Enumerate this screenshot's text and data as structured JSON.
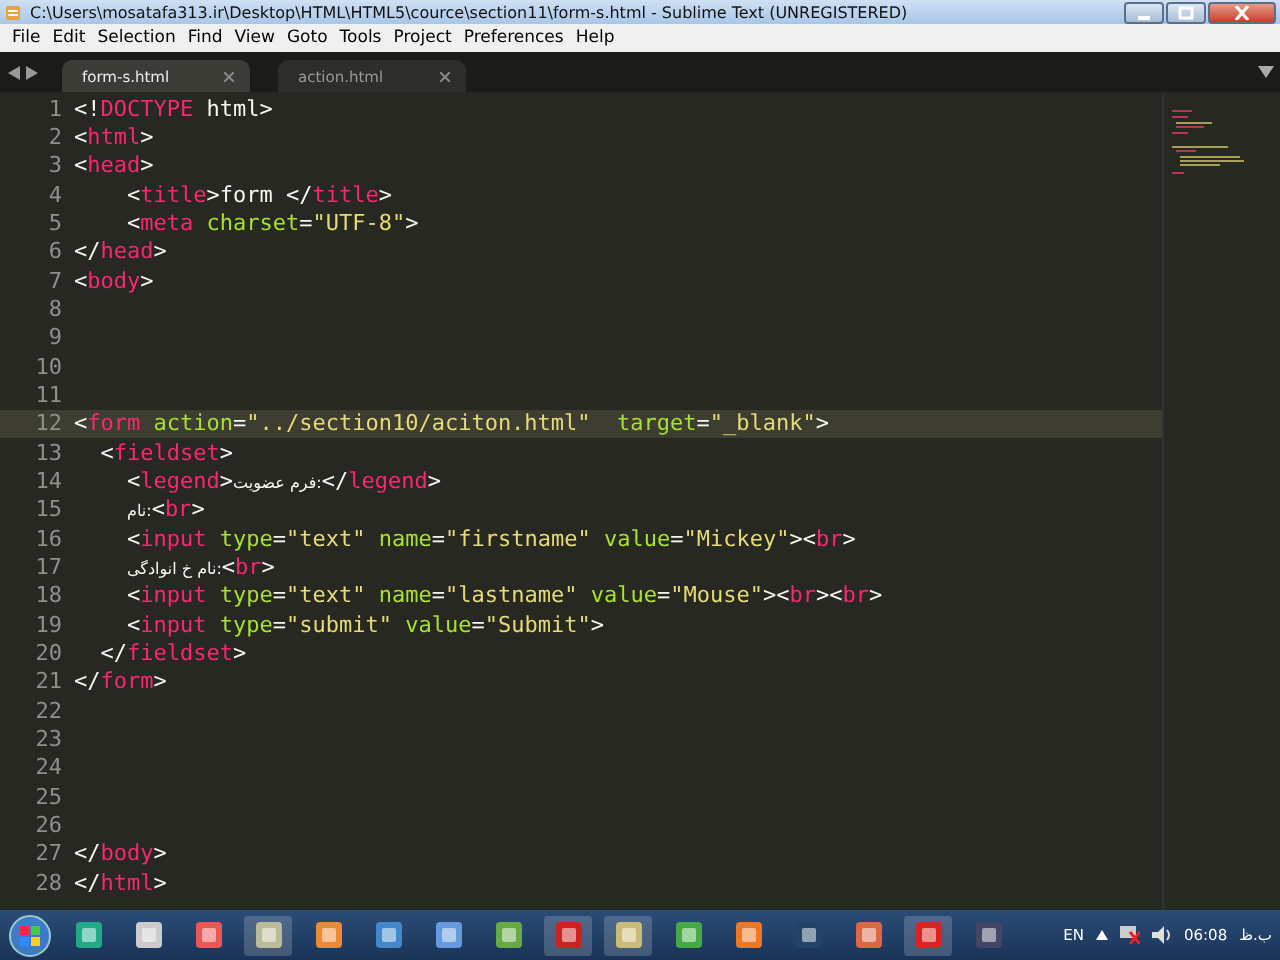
{
  "window": {
    "title": "C:\\Users\\mosatafa313.ir\\Desktop\\HTML\\HTML5\\cource\\section11\\form-s.html - Sublime Text (UNREGISTERED)"
  },
  "menu": [
    "File",
    "Edit",
    "Selection",
    "Find",
    "View",
    "Goto",
    "Tools",
    "Project",
    "Preferences",
    "Help"
  ],
  "tabs": [
    {
      "label": "form-s.html",
      "selected": true
    },
    {
      "label": "action.html",
      "selected": false
    }
  ],
  "editor": {
    "lines": [
      {
        "number": "1",
        "current": false,
        "tokens": [
          {
            "kind": "punct",
            "text": "<!"
          },
          {
            "kind": "tag",
            "text": "DOCTYPE"
          },
          {
            "kind": "plain",
            "text": " html"
          },
          {
            "kind": "punct",
            "text": ">"
          }
        ]
      },
      {
        "number": "2",
        "current": false,
        "tokens": [
          {
            "kind": "punct",
            "text": "<"
          },
          {
            "kind": "tag",
            "text": "html"
          },
          {
            "kind": "punct",
            "text": ">"
          }
        ]
      },
      {
        "number": "3",
        "current": false,
        "tokens": [
          {
            "kind": "punct",
            "text": "<"
          },
          {
            "kind": "tag",
            "text": "head"
          },
          {
            "kind": "punct",
            "text": ">"
          }
        ]
      },
      {
        "number": "4",
        "current": false,
        "tokens": [
          {
            "kind": "punct",
            "text": "    <"
          },
          {
            "kind": "tag",
            "text": "title"
          },
          {
            "kind": "punct",
            "text": ">"
          },
          {
            "kind": "plain",
            "text": "form "
          },
          {
            "kind": "punct",
            "text": "</"
          },
          {
            "kind": "tag",
            "text": "title"
          },
          {
            "kind": "punct",
            "text": ">"
          }
        ]
      },
      {
        "number": "5",
        "current": false,
        "tokens": [
          {
            "kind": "punct",
            "text": "    <"
          },
          {
            "kind": "tag",
            "text": "meta"
          },
          {
            "kind": "attr",
            "text": " charset"
          },
          {
            "kind": "punct",
            "text": "="
          },
          {
            "kind": "string",
            "text": "\"UTF-8\""
          },
          {
            "kind": "punct",
            "text": ">"
          }
        ]
      },
      {
        "number": "6",
        "current": false,
        "tokens": [
          {
            "kind": "punct",
            "text": "</"
          },
          {
            "kind": "tag",
            "text": "head"
          },
          {
            "kind": "punct",
            "text": ">"
          }
        ]
      },
      {
        "number": "7",
        "current": false,
        "tokens": [
          {
            "kind": "punct",
            "text": "<"
          },
          {
            "kind": "tag",
            "text": "body"
          },
          {
            "kind": "punct",
            "text": ">"
          }
        ]
      },
      {
        "number": "8",
        "current": false
      },
      {
        "number": "9",
        "current": false
      },
      {
        "number": "10",
        "current": false
      },
      {
        "number": "11",
        "current": false
      },
      {
        "number": "12",
        "current": true,
        "tokens": [
          {
            "kind": "punct",
            "text": "<"
          },
          {
            "kind": "tag",
            "text": "form"
          },
          {
            "kind": "attr",
            "text": " action"
          },
          {
            "kind": "punct",
            "text": "="
          },
          {
            "kind": "string",
            "text": "\"../section10/aciton.html\""
          },
          {
            "kind": "attr",
            "text": "  target"
          },
          {
            "kind": "punct",
            "text": "="
          },
          {
            "kind": "string",
            "text": "\"_blank\""
          },
          {
            "kind": "punct",
            "text": ">"
          }
        ]
      },
      {
        "number": "13",
        "current": false,
        "tokens": [
          {
            "kind": "punct",
            "text": "  <"
          },
          {
            "kind": "tag",
            "text": "fieldset"
          },
          {
            "kind": "punct",
            "text": ">"
          }
        ]
      },
      {
        "number": "14",
        "current": false,
        "tokens": [
          {
            "kind": "punct",
            "text": "    <"
          },
          {
            "kind": "tag",
            "text": "legend"
          },
          {
            "kind": "punct",
            "text": ">"
          },
          {
            "kind": "rtl",
            "text": "تیوضع مرف:"
          },
          {
            "kind": "punct",
            "text": "</"
          },
          {
            "kind": "tag",
            "text": "legend"
          },
          {
            "kind": "punct",
            "text": ">"
          }
        ]
      },
      {
        "number": "15",
        "current": false,
        "tokens": [
          {
            "kind": "rtl",
            "text": "    مان:"
          },
          {
            "kind": "punct",
            "text": "<"
          },
          {
            "kind": "tag",
            "text": "br"
          },
          {
            "kind": "punct",
            "text": ">"
          }
        ]
      },
      {
        "number": "16",
        "current": false,
        "tokens": [
          {
            "kind": "punct",
            "text": "    <"
          },
          {
            "kind": "tag",
            "text": "input"
          },
          {
            "kind": "attr",
            "text": " type"
          },
          {
            "kind": "punct",
            "text": "="
          },
          {
            "kind": "string",
            "text": "\"text\""
          },
          {
            "kind": "attr",
            "text": " name"
          },
          {
            "kind": "punct",
            "text": "="
          },
          {
            "kind": "string",
            "text": "\"firstname\""
          },
          {
            "kind": "attr",
            "text": " value"
          },
          {
            "kind": "punct",
            "text": "="
          },
          {
            "kind": "string",
            "text": "\"Mickey\""
          },
          {
            "kind": "punct",
            "text": "><"
          },
          {
            "kind": "tag",
            "text": "br"
          },
          {
            "kind": "punct",
            "text": ">"
          }
        ]
      },
      {
        "number": "17",
        "current": false,
        "tokens": [
          {
            "kind": "rtl",
            "text": "    یگداونا خ مان:"
          },
          {
            "kind": "punct",
            "text": "<"
          },
          {
            "kind": "tag",
            "text": "br"
          },
          {
            "kind": "punct",
            "text": ">"
          }
        ]
      },
      {
        "number": "18",
        "current": false,
        "tokens": [
          {
            "kind": "punct",
            "text": "    <"
          },
          {
            "kind": "tag",
            "text": "input"
          },
          {
            "kind": "attr",
            "text": " type"
          },
          {
            "kind": "punct",
            "text": "="
          },
          {
            "kind": "string",
            "text": "\"text\""
          },
          {
            "kind": "attr",
            "text": " name"
          },
          {
            "kind": "punct",
            "text": "="
          },
          {
            "kind": "string",
            "text": "\"lastname\""
          },
          {
            "kind": "attr",
            "text": " value"
          },
          {
            "kind": "punct",
            "text": "="
          },
          {
            "kind": "string",
            "text": "\"Mouse\""
          },
          {
            "kind": "punct",
            "text": "><"
          },
          {
            "kind": "tag",
            "text": "br"
          },
          {
            "kind": "punct",
            "text": "><"
          },
          {
            "kind": "tag",
            "text": "br"
          },
          {
            "kind": "punct",
            "text": ">"
          }
        ]
      },
      {
        "number": "19",
        "current": false,
        "tokens": [
          {
            "kind": "punct",
            "text": "    <"
          },
          {
            "kind": "tag",
            "text": "input"
          },
          {
            "kind": "attr",
            "text": " type"
          },
          {
            "kind": "punct",
            "text": "="
          },
          {
            "kind": "string",
            "text": "\"submit\""
          },
          {
            "kind": "attr",
            "text": " value"
          },
          {
            "kind": "punct",
            "text": "="
          },
          {
            "kind": "string",
            "text": "\"Submit\""
          },
          {
            "kind": "punct",
            "text": ">"
          }
        ]
      },
      {
        "number": "20",
        "current": false,
        "tokens": [
          {
            "kind": "punct",
            "text": "  </"
          },
          {
            "kind": "tag",
            "text": "fieldset"
          },
          {
            "kind": "punct",
            "text": ">"
          }
        ]
      },
      {
        "number": "21",
        "current": false,
        "tokens": [
          {
            "kind": "punct",
            "text": "</"
          },
          {
            "kind": "tag",
            "text": "form"
          },
          {
            "kind": "punct",
            "text": ">"
          }
        ]
      },
      {
        "number": "22",
        "current": false
      },
      {
        "number": "23",
        "current": false
      },
      {
        "number": "24",
        "current": false
      },
      {
        "number": "25",
        "current": false
      },
      {
        "number": "26",
        "current": false
      },
      {
        "number": "27",
        "current": false,
        "tokens": [
          {
            "kind": "punct",
            "text": "</"
          },
          {
            "kind": "tag",
            "text": "body"
          },
          {
            "kind": "punct",
            "text": ">"
          }
        ]
      },
      {
        "number": "28",
        "current": false,
        "tokens": [
          {
            "kind": "punct",
            "text": "</"
          },
          {
            "kind": "tag",
            "text": "html"
          },
          {
            "kind": "punct",
            "text": ">"
          }
        ]
      }
    ]
  },
  "taskbar": {
    "language": "EN",
    "time": "06:08",
    "period": "ب.ظ"
  }
}
